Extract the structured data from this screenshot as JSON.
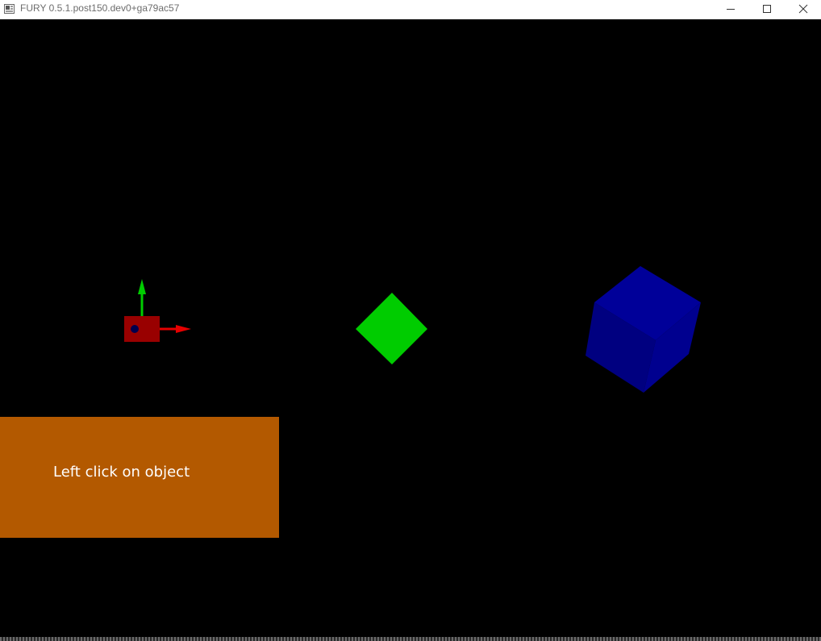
{
  "window": {
    "title": "FURY 0.5.1.post150.dev0+ga79ac57",
    "controls": {
      "minimize_icon": "minimize-icon",
      "maximize_icon": "maximize-icon",
      "close_icon": "close-icon"
    }
  },
  "scene": {
    "background_color": "#000000",
    "objects": [
      {
        "kind": "small red box with axes",
        "box_color": "#990000",
        "dot_color": "#00004d",
        "x_axis_color": "#e60000",
        "y_axis_color": "#00cc00"
      },
      {
        "kind": "green diamond",
        "color": "#00cc00"
      },
      {
        "kind": "blue cube",
        "color": "#000099"
      }
    ]
  },
  "panel": {
    "text": "Left click on object",
    "color": "#b35900",
    "text_color": "#ffffff"
  }
}
